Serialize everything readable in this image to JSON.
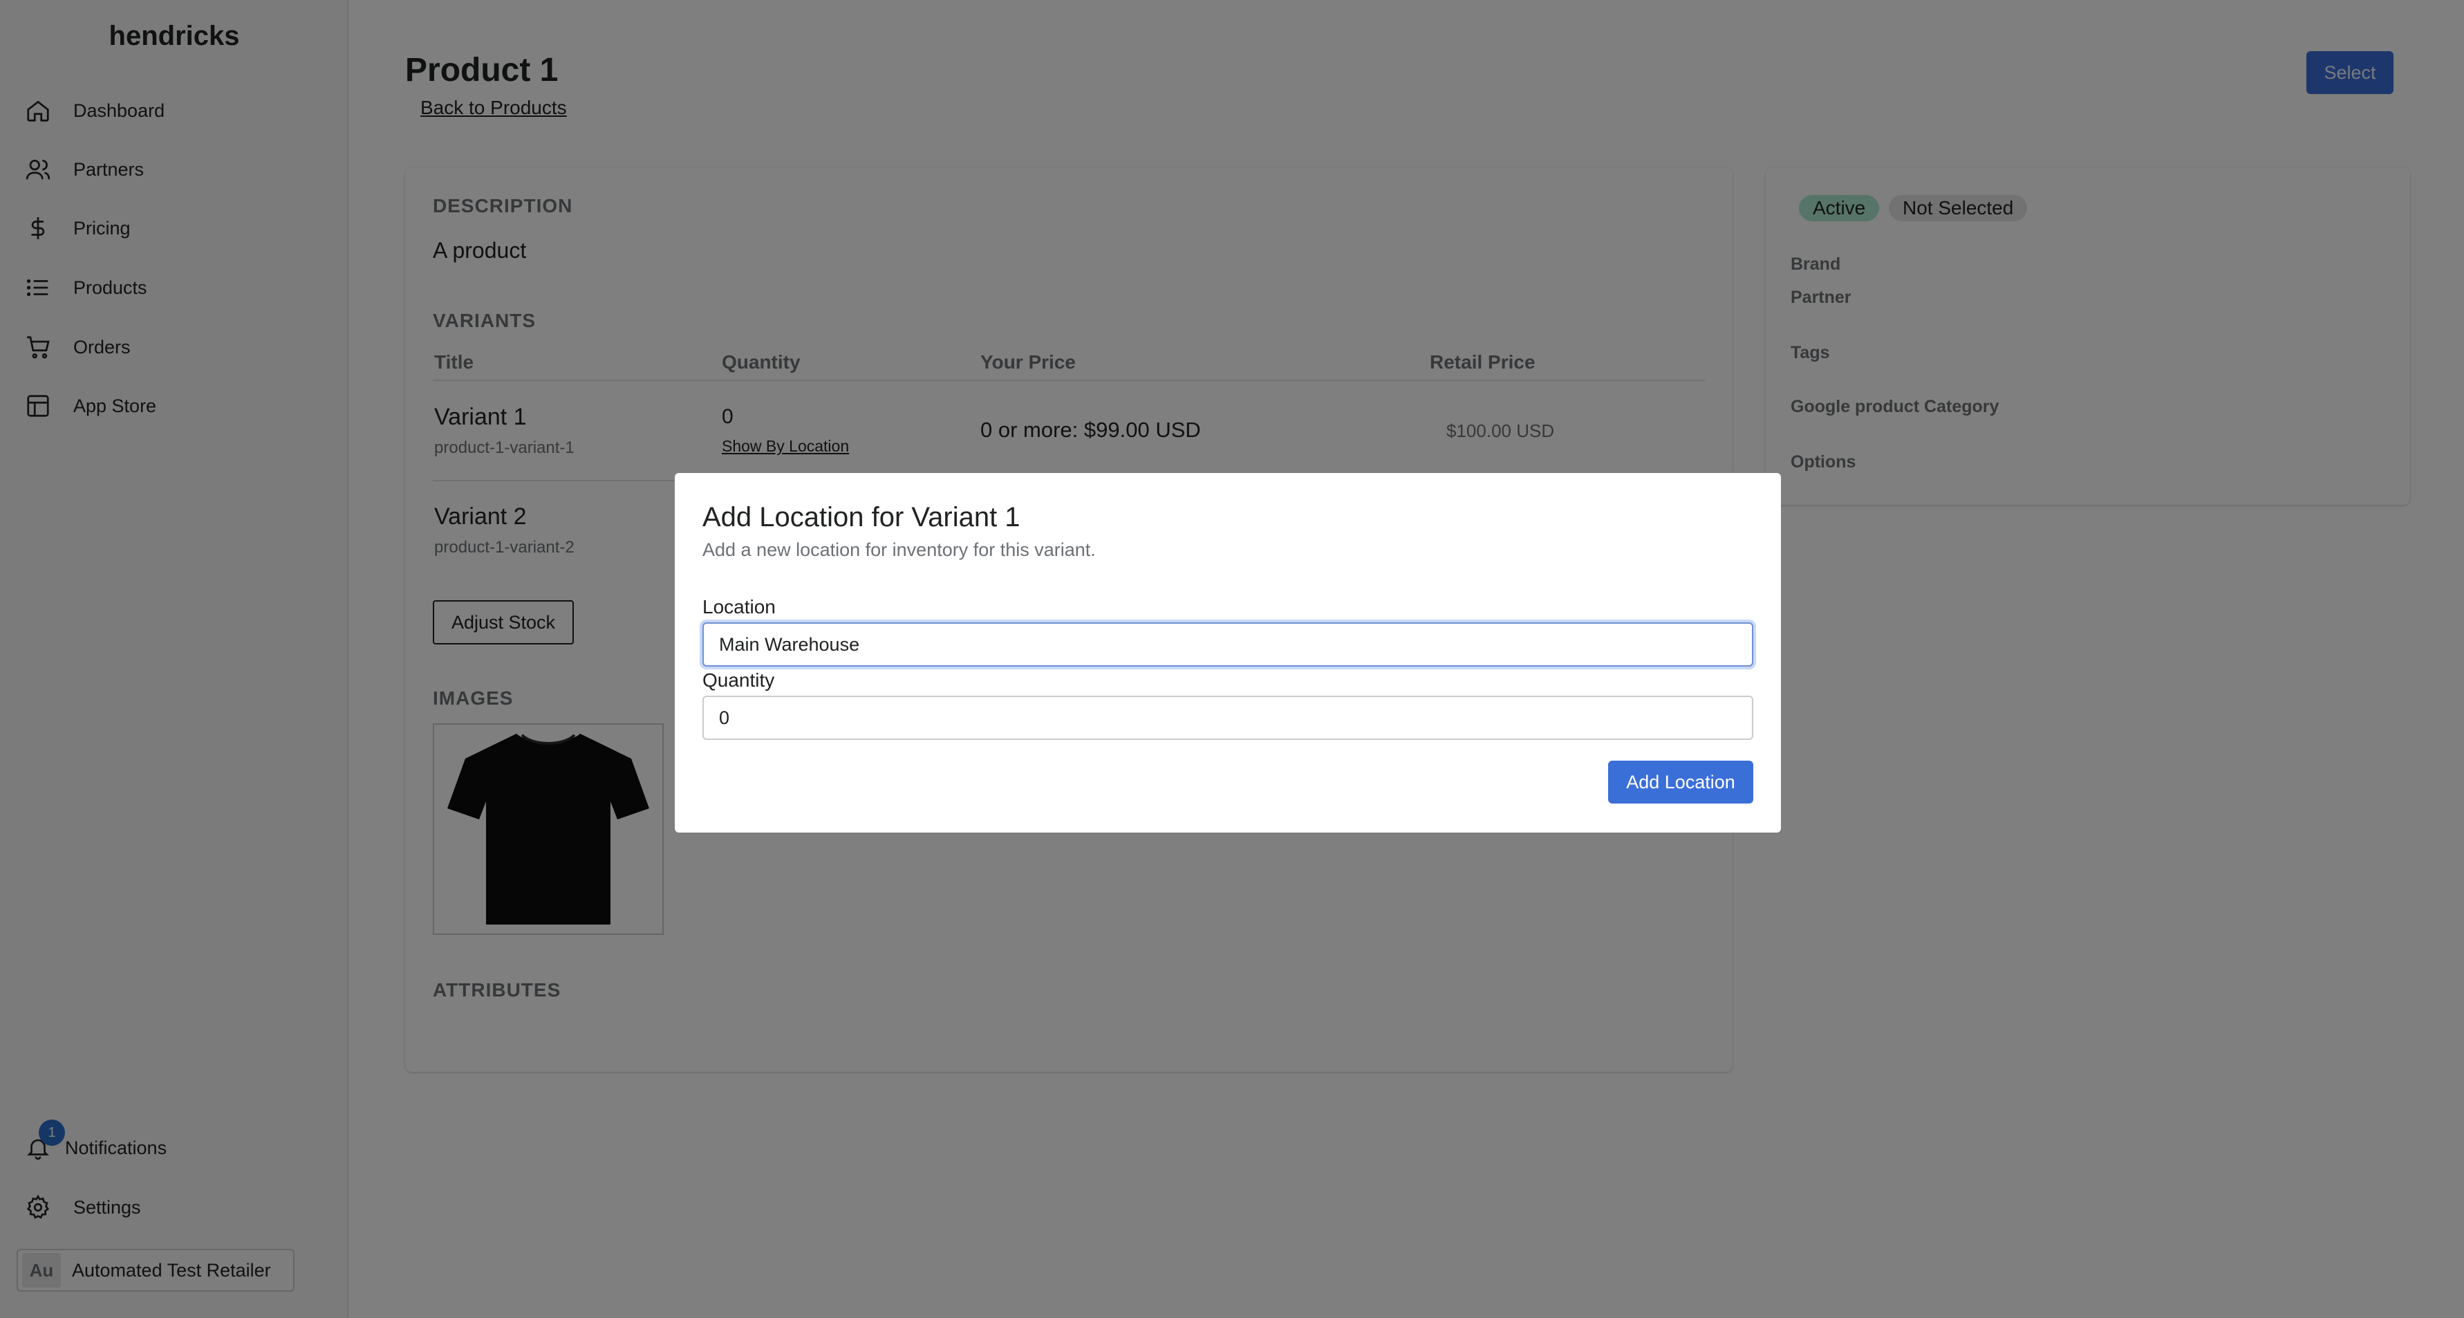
{
  "sidebar": {
    "brand": "hendricks",
    "nav": [
      {
        "label": "Dashboard",
        "icon": "home-icon"
      },
      {
        "label": "Partners",
        "icon": "users-icon"
      },
      {
        "label": "Pricing",
        "icon": "dollar-icon"
      },
      {
        "label": "Products",
        "icon": "list-icon"
      },
      {
        "label": "Orders",
        "icon": "cart-icon"
      },
      {
        "label": "App Store",
        "icon": "app-store-icon"
      }
    ],
    "notifications": {
      "label": "Notifications",
      "count": "1",
      "icon": "bell-icon"
    },
    "settings": {
      "label": "Settings",
      "icon": "gear-icon"
    },
    "account": {
      "initials": "Au",
      "name": "Automated Test Retailer"
    }
  },
  "header": {
    "title": "Product 1",
    "back_link": "Back to Products",
    "select_label": "Select"
  },
  "product": {
    "description_label": "DESCRIPTION",
    "description": "A product",
    "variants_label": "VARIANTS",
    "columns": [
      "Title",
      "Quantity",
      "Your Price",
      "Retail Price"
    ],
    "variants": [
      {
        "title": "Variant 1",
        "handle": "product-1-variant-1",
        "quantity": "0",
        "location_link": "Show By Location",
        "price": "0 or more: $99.00 USD",
        "retail": "$100.00 USD"
      },
      {
        "title": "Variant 2",
        "handle": "product-1-variant-2"
      }
    ],
    "adjust_stock_label": "Adjust Stock",
    "images_label": "IMAGES",
    "attributes_label": "ATTRIBUTES"
  },
  "side_panel": {
    "status_active": "Active",
    "status_selected": "Not Selected",
    "fields": [
      "Brand",
      "Partner",
      "Tags",
      "Google product Category",
      "Options"
    ]
  },
  "modal": {
    "title": "Add Location for Variant 1",
    "subtitle": "Add a new location for inventory for this variant.",
    "location_label": "Location",
    "location_value": "Main Warehouse",
    "quantity_label": "Quantity",
    "quantity_value": "0",
    "submit_label": "Add Location"
  },
  "colors": {
    "primary": "#3b6fd8",
    "active_badge": "#aee9d1",
    "overlay": "rgba(0,0,0,0.5)"
  }
}
